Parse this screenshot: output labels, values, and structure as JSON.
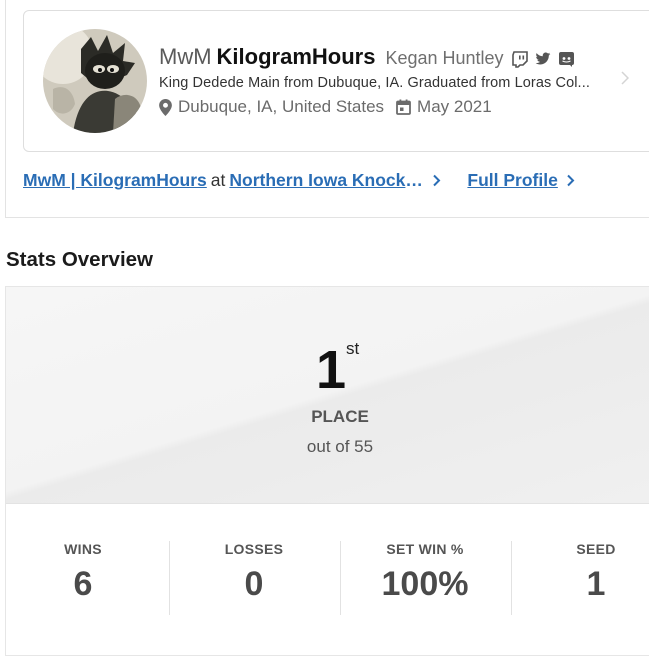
{
  "profile": {
    "prefix": "MwM",
    "gamertag": "KilogramHours",
    "real_name": "Kegan Huntley",
    "bio": "King Dedede Main from Dubuque, IA. Graduated from Loras Col...",
    "location": "Dubuque, IA, United States",
    "joined": "May 2021",
    "social_icons": [
      "twitch-icon",
      "twitter-icon",
      "discord-icon"
    ]
  },
  "links": {
    "entrant_link": "MwM | KilogramHours",
    "at_text": "at",
    "event_link": "Northern Iowa Knockout...",
    "full_profile": "Full Profile"
  },
  "stats": {
    "section_title": "Stats Overview",
    "place_number": "1",
    "place_suffix": "st",
    "place_label": "PLACE",
    "out_of": "out of 55",
    "items": [
      {
        "label": "WINS",
        "value": "6"
      },
      {
        "label": "LOSSES",
        "value": "0"
      },
      {
        "label": "SET WIN %",
        "value": "100%"
      },
      {
        "label": "SEED",
        "value": "1"
      }
    ]
  },
  "colors": {
    "link": "#2a6db5",
    "text": "#222222",
    "muted": "#6b6b6b"
  }
}
